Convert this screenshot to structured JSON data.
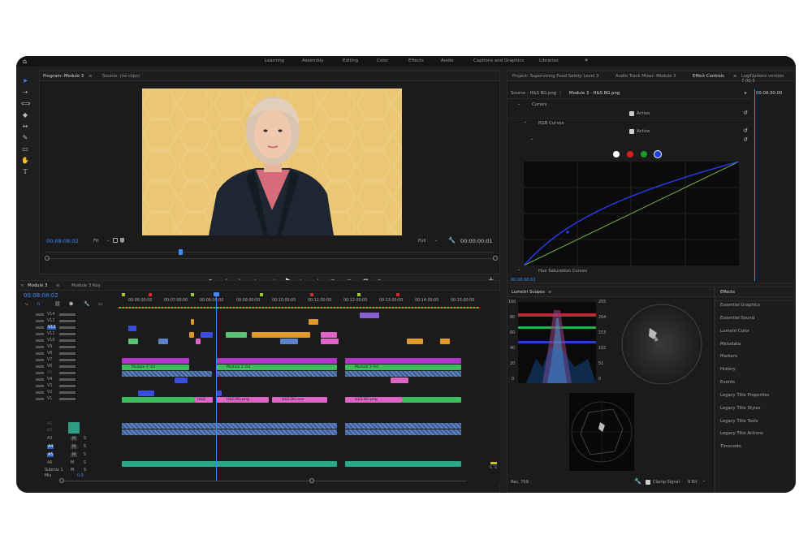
{
  "workspaces": [
    "Learning",
    "Assembly",
    "Editing",
    "Color",
    "Effects",
    "Audio",
    "Captions and Graphics",
    "Libraries"
  ],
  "workspaces_more": "»",
  "program": {
    "tabs": [
      "Program: Module 3",
      "Source: (no clips)"
    ],
    "timecode": "00:08:08:02",
    "fit": "Fit",
    "quality": "Full",
    "duration": "00:00:00:01"
  },
  "project_tabs": [
    "Project: Supervising Food Safety Level 3",
    "Audio Track Mixer: Module 3",
    "Effect Controls",
    "LogiOptions version 7.00.5"
  ],
  "effect_controls": {
    "source_tab": "Source - H&S BG.png",
    "seq_tab": "Module 3 - H&S BG.png",
    "ruler_time": "00;08;30;00",
    "curves": "Curves",
    "active": "Active",
    "rgb_curves": "RGB Curves",
    "active2": "Active",
    "hue_sat": "Hue Saturation Curves",
    "timecode": "00:08:08:02"
  },
  "timeline": {
    "tabs": [
      "Module 3",
      "Module 3 Key"
    ],
    "timecode": "00:08:08:02",
    "ruler": [
      "00:06:00:00",
      "00:07:00:00",
      "00:08:00:00",
      "00:09:00:00",
      "00:10:00:00",
      "00:11:00:00",
      "00:12:00:00",
      "00:13:00:00",
      "00:14:00:00",
      "00:15:00:00"
    ],
    "video_tracks": [
      "V14",
      "V13",
      "V12",
      "V11",
      "V10",
      "V9",
      "V8",
      "V7",
      "V6",
      "V5",
      "V4",
      "V3",
      "V2",
      "V1"
    ],
    "audio_tracks": [
      "A1",
      "A2",
      "A3",
      "A4",
      "A5",
      "A6"
    ],
    "submix": "Submix 1",
    "mix": "Mix",
    "mix_value": "0.0",
    "m_label": "M",
    "s_label": "S",
    "clip_labels": {
      "module3vid": "Module 3 Vid",
      "module3key": "Module 3 Key",
      "hs_bg": "H&S BG.png",
      "hs_bg_short": "H&S",
      "hs_bgone": "H&S BG.one"
    }
  },
  "lumetri": {
    "tab": "Lumetri Scopes",
    "scale_left": [
      "100",
      "80",
      "60",
      "40",
      "20",
      "0"
    ],
    "scale_right": [
      "255",
      "204",
      "153",
      "102",
      "51",
      "0"
    ],
    "rec": "Rec. 709",
    "clamp": "Clamp Signal",
    "bits": "8 Bit"
  },
  "effects_panel": {
    "items": [
      "Effects",
      "Essential Graphics",
      "Essential Sound",
      "Lumetri Color",
      "Metadata",
      "Markers",
      "History",
      "Events",
      "Legacy Title Properties",
      "Legacy Title Styles",
      "Legacy Title Tools",
      "Legacy Title Actions",
      "Timecode"
    ]
  },
  "meter": {
    "left": "S",
    "right": "S"
  },
  "colors": {
    "accent": "#3d8bff",
    "video_clip": "#7a54c8",
    "green_clip": "#3fbf5b",
    "pink_clip": "#e064c8",
    "audio_clip": "#5e83c9",
    "orange_clip": "#e09a2c"
  }
}
